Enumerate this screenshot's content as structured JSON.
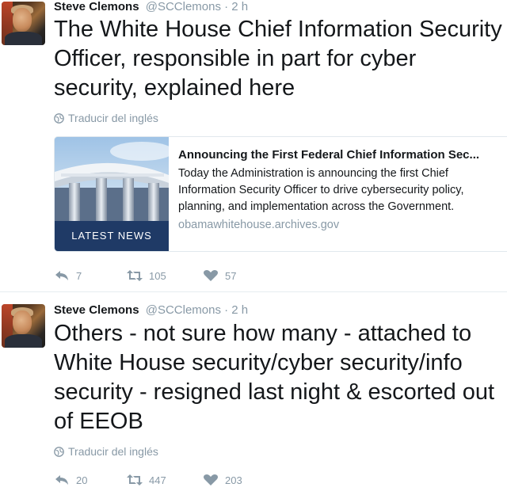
{
  "tweets": [
    {
      "author_name": "Steve Clemons",
      "handle_time": "@SCClemons · 2 h",
      "text": "The White House Chief Information Security Officer, responsible in part for cyber security, explained here",
      "translate_label": "Traducir del inglés",
      "card": {
        "image_label": "LATEST NEWS",
        "title": "Announcing the First Federal Chief Information Sec...",
        "description": "Today the Administration is announcing the first Chief Information Security Officer to drive cybersecurity policy, planning, and implementation across the Government.",
        "domain": "obamawhitehouse.archives.gov"
      },
      "replies": "7",
      "retweets": "105",
      "likes": "57"
    },
    {
      "author_name": "Steve Clemons",
      "handle_time": "@SCClemons · 2 h",
      "text": "Others - not sure how many - attached to White House security/cyber security/info security - resigned last night & escorted out of EEOB",
      "translate_label": "Traducir del inglés",
      "replies": "20",
      "retweets": "447",
      "likes": "203"
    }
  ],
  "icons": {
    "reply": "reply-icon",
    "retweet": "retweet-icon",
    "like": "heart-icon",
    "translate": "globe-icon"
  },
  "colors": {
    "muted": "#8899a6",
    "text": "#14171a",
    "card_banner": "#1f3a66"
  }
}
